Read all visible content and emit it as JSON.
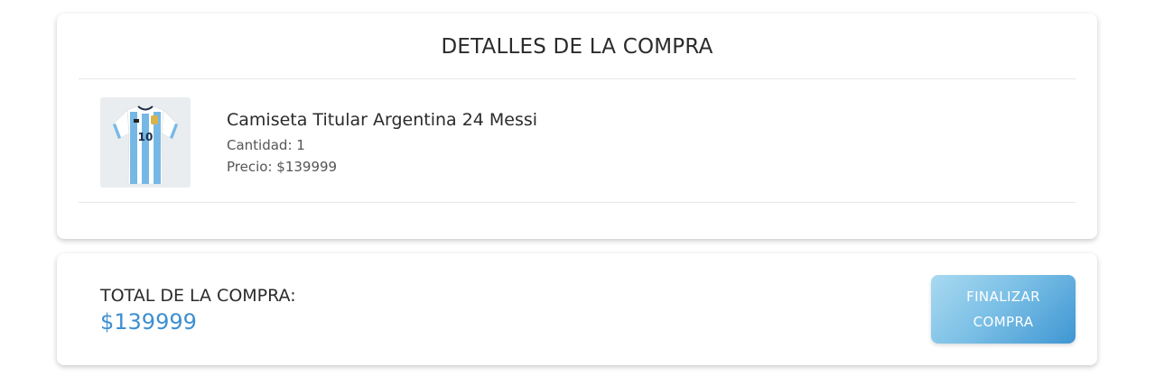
{
  "details": {
    "title": "DETALLES DE LA COMPRA",
    "items": [
      {
        "name": "Camiseta Titular Argentina 24 Messi",
        "quantity_label": "Cantidad:",
        "quantity": "1",
        "price_label": "Precio:",
        "price": "$139999",
        "image_icon": "argentina-jersey-image",
        "jersey_number": "10"
      }
    ]
  },
  "summary": {
    "total_label": "TOTAL DE LA COMPRA:",
    "total_value": "$139999",
    "finalize_label": "FINALIZAR COMPRA"
  },
  "colors": {
    "accent": "#3d8fd1",
    "button_light": "#a9d9f0",
    "button_dark": "#3f96d3",
    "jersey_blue": "#75b8e6"
  }
}
